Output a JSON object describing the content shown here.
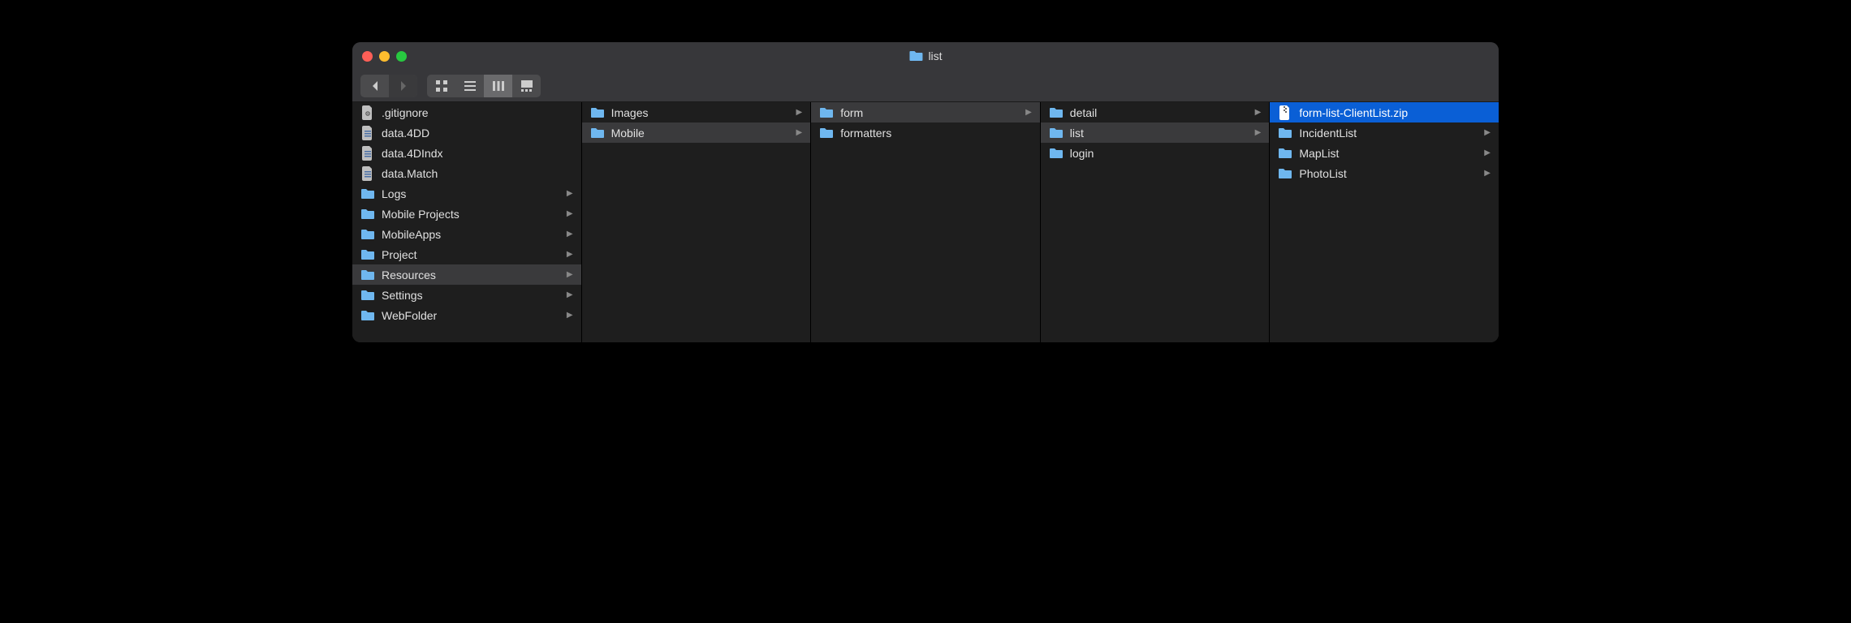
{
  "window": {
    "title": "list",
    "titleIcon": "folder"
  },
  "columns": [
    {
      "items": [
        {
          "label": ".gitignore",
          "icon": "gear-file",
          "hasArrow": false,
          "active": false,
          "selected": false
        },
        {
          "label": "data.4DD",
          "icon": "db-file",
          "hasArrow": false,
          "active": false,
          "selected": false
        },
        {
          "label": "data.4DIndx",
          "icon": "db-file",
          "hasArrow": false,
          "active": false,
          "selected": false
        },
        {
          "label": "data.Match",
          "icon": "db-file",
          "hasArrow": false,
          "active": false,
          "selected": false
        },
        {
          "label": "Logs",
          "icon": "folder",
          "hasArrow": true,
          "active": false,
          "selected": false
        },
        {
          "label": "Mobile Projects",
          "icon": "folder",
          "hasArrow": true,
          "active": false,
          "selected": false
        },
        {
          "label": "MobileApps",
          "icon": "folder",
          "hasArrow": true,
          "active": false,
          "selected": false
        },
        {
          "label": "Project",
          "icon": "folder",
          "hasArrow": true,
          "active": false,
          "selected": false
        },
        {
          "label": "Resources",
          "icon": "folder",
          "hasArrow": true,
          "active": true,
          "selected": false
        },
        {
          "label": "Settings",
          "icon": "folder",
          "hasArrow": true,
          "active": false,
          "selected": false
        },
        {
          "label": "WebFolder",
          "icon": "folder",
          "hasArrow": true,
          "active": false,
          "selected": false
        }
      ]
    },
    {
      "items": [
        {
          "label": "Images",
          "icon": "folder",
          "hasArrow": true,
          "active": false,
          "selected": false
        },
        {
          "label": "Mobile",
          "icon": "folder",
          "hasArrow": true,
          "active": true,
          "selected": false
        }
      ]
    },
    {
      "items": [
        {
          "label": "form",
          "icon": "folder",
          "hasArrow": true,
          "active": true,
          "selected": false
        },
        {
          "label": "formatters",
          "icon": "folder",
          "hasArrow": false,
          "active": false,
          "selected": false
        }
      ]
    },
    {
      "items": [
        {
          "label": "detail",
          "icon": "folder",
          "hasArrow": true,
          "active": false,
          "selected": false
        },
        {
          "label": "list",
          "icon": "folder",
          "hasArrow": true,
          "active": true,
          "selected": false
        },
        {
          "label": "login",
          "icon": "folder",
          "hasArrow": false,
          "active": false,
          "selected": false
        }
      ]
    },
    {
      "items": [
        {
          "label": "form-list-ClientList.zip",
          "icon": "zip-file",
          "hasArrow": false,
          "active": false,
          "selected": true
        },
        {
          "label": "IncidentList",
          "icon": "folder",
          "hasArrow": true,
          "active": false,
          "selected": false
        },
        {
          "label": "MapList",
          "icon": "folder",
          "hasArrow": true,
          "active": false,
          "selected": false
        },
        {
          "label": "PhotoList",
          "icon": "folder",
          "hasArrow": true,
          "active": false,
          "selected": false
        }
      ]
    }
  ]
}
